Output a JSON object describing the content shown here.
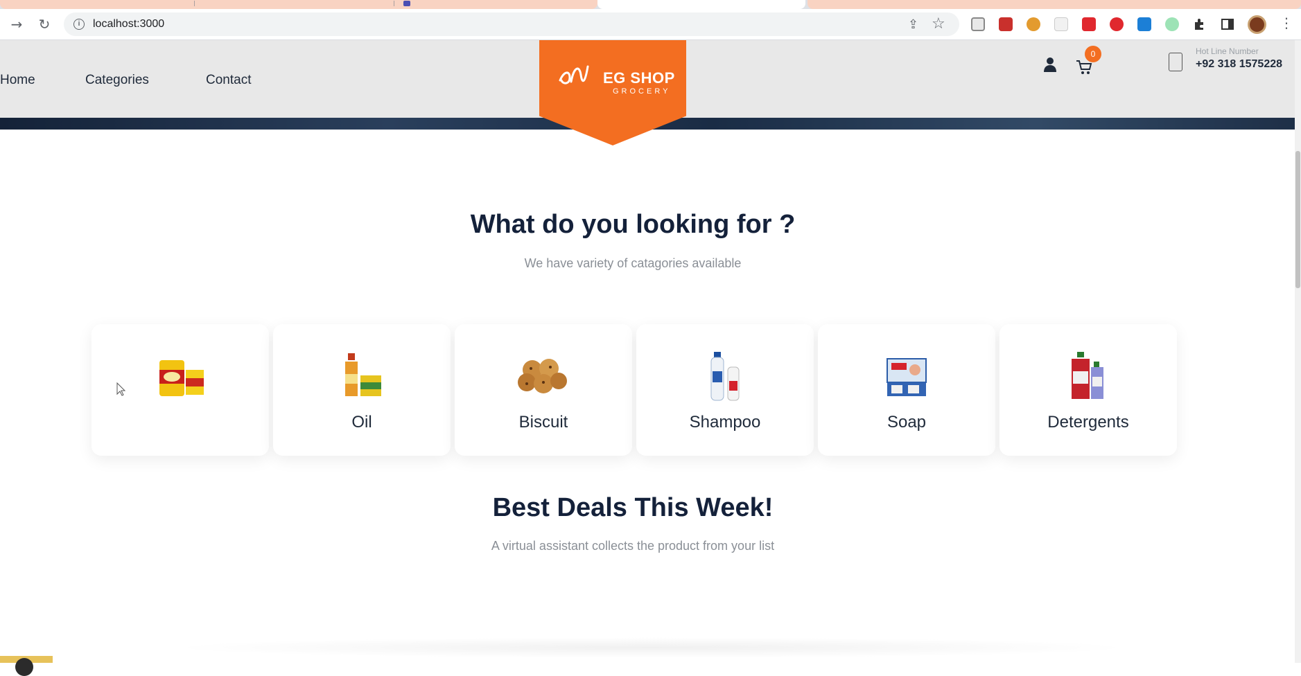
{
  "browser": {
    "url": "localhost:3000",
    "nav": {
      "back_icon": "arrow-right-icon",
      "reload_icon": "reload-icon"
    }
  },
  "site": {
    "nav": [
      "Home",
      "Categories",
      "Contact"
    ],
    "logo": {
      "title": "EG SHOP",
      "subtitle": "GROCERY"
    },
    "cart_count": "0",
    "hotline": {
      "label": "Hot Line Number",
      "number": "+92 318 1575228"
    },
    "brand_color": "#f36e21"
  },
  "categories_section": {
    "title": "What do you looking for ?",
    "subtitle": "We have variety of catagories available",
    "items": [
      {
        "label": "",
        "icon": "spice-product-icon"
      },
      {
        "label": "Oil",
        "icon": "oil-bottle-icon"
      },
      {
        "label": "Biscuit",
        "icon": "cookies-icon"
      },
      {
        "label": "Shampoo",
        "icon": "shampoo-bottle-icon"
      },
      {
        "label": "Soap",
        "icon": "soap-box-icon"
      },
      {
        "label": "Detergents",
        "icon": "detergent-bottle-icon"
      }
    ]
  },
  "deals_section": {
    "title": "Best Deals This Week!",
    "subtitle": "A virtual assistant collects the product from your list"
  }
}
